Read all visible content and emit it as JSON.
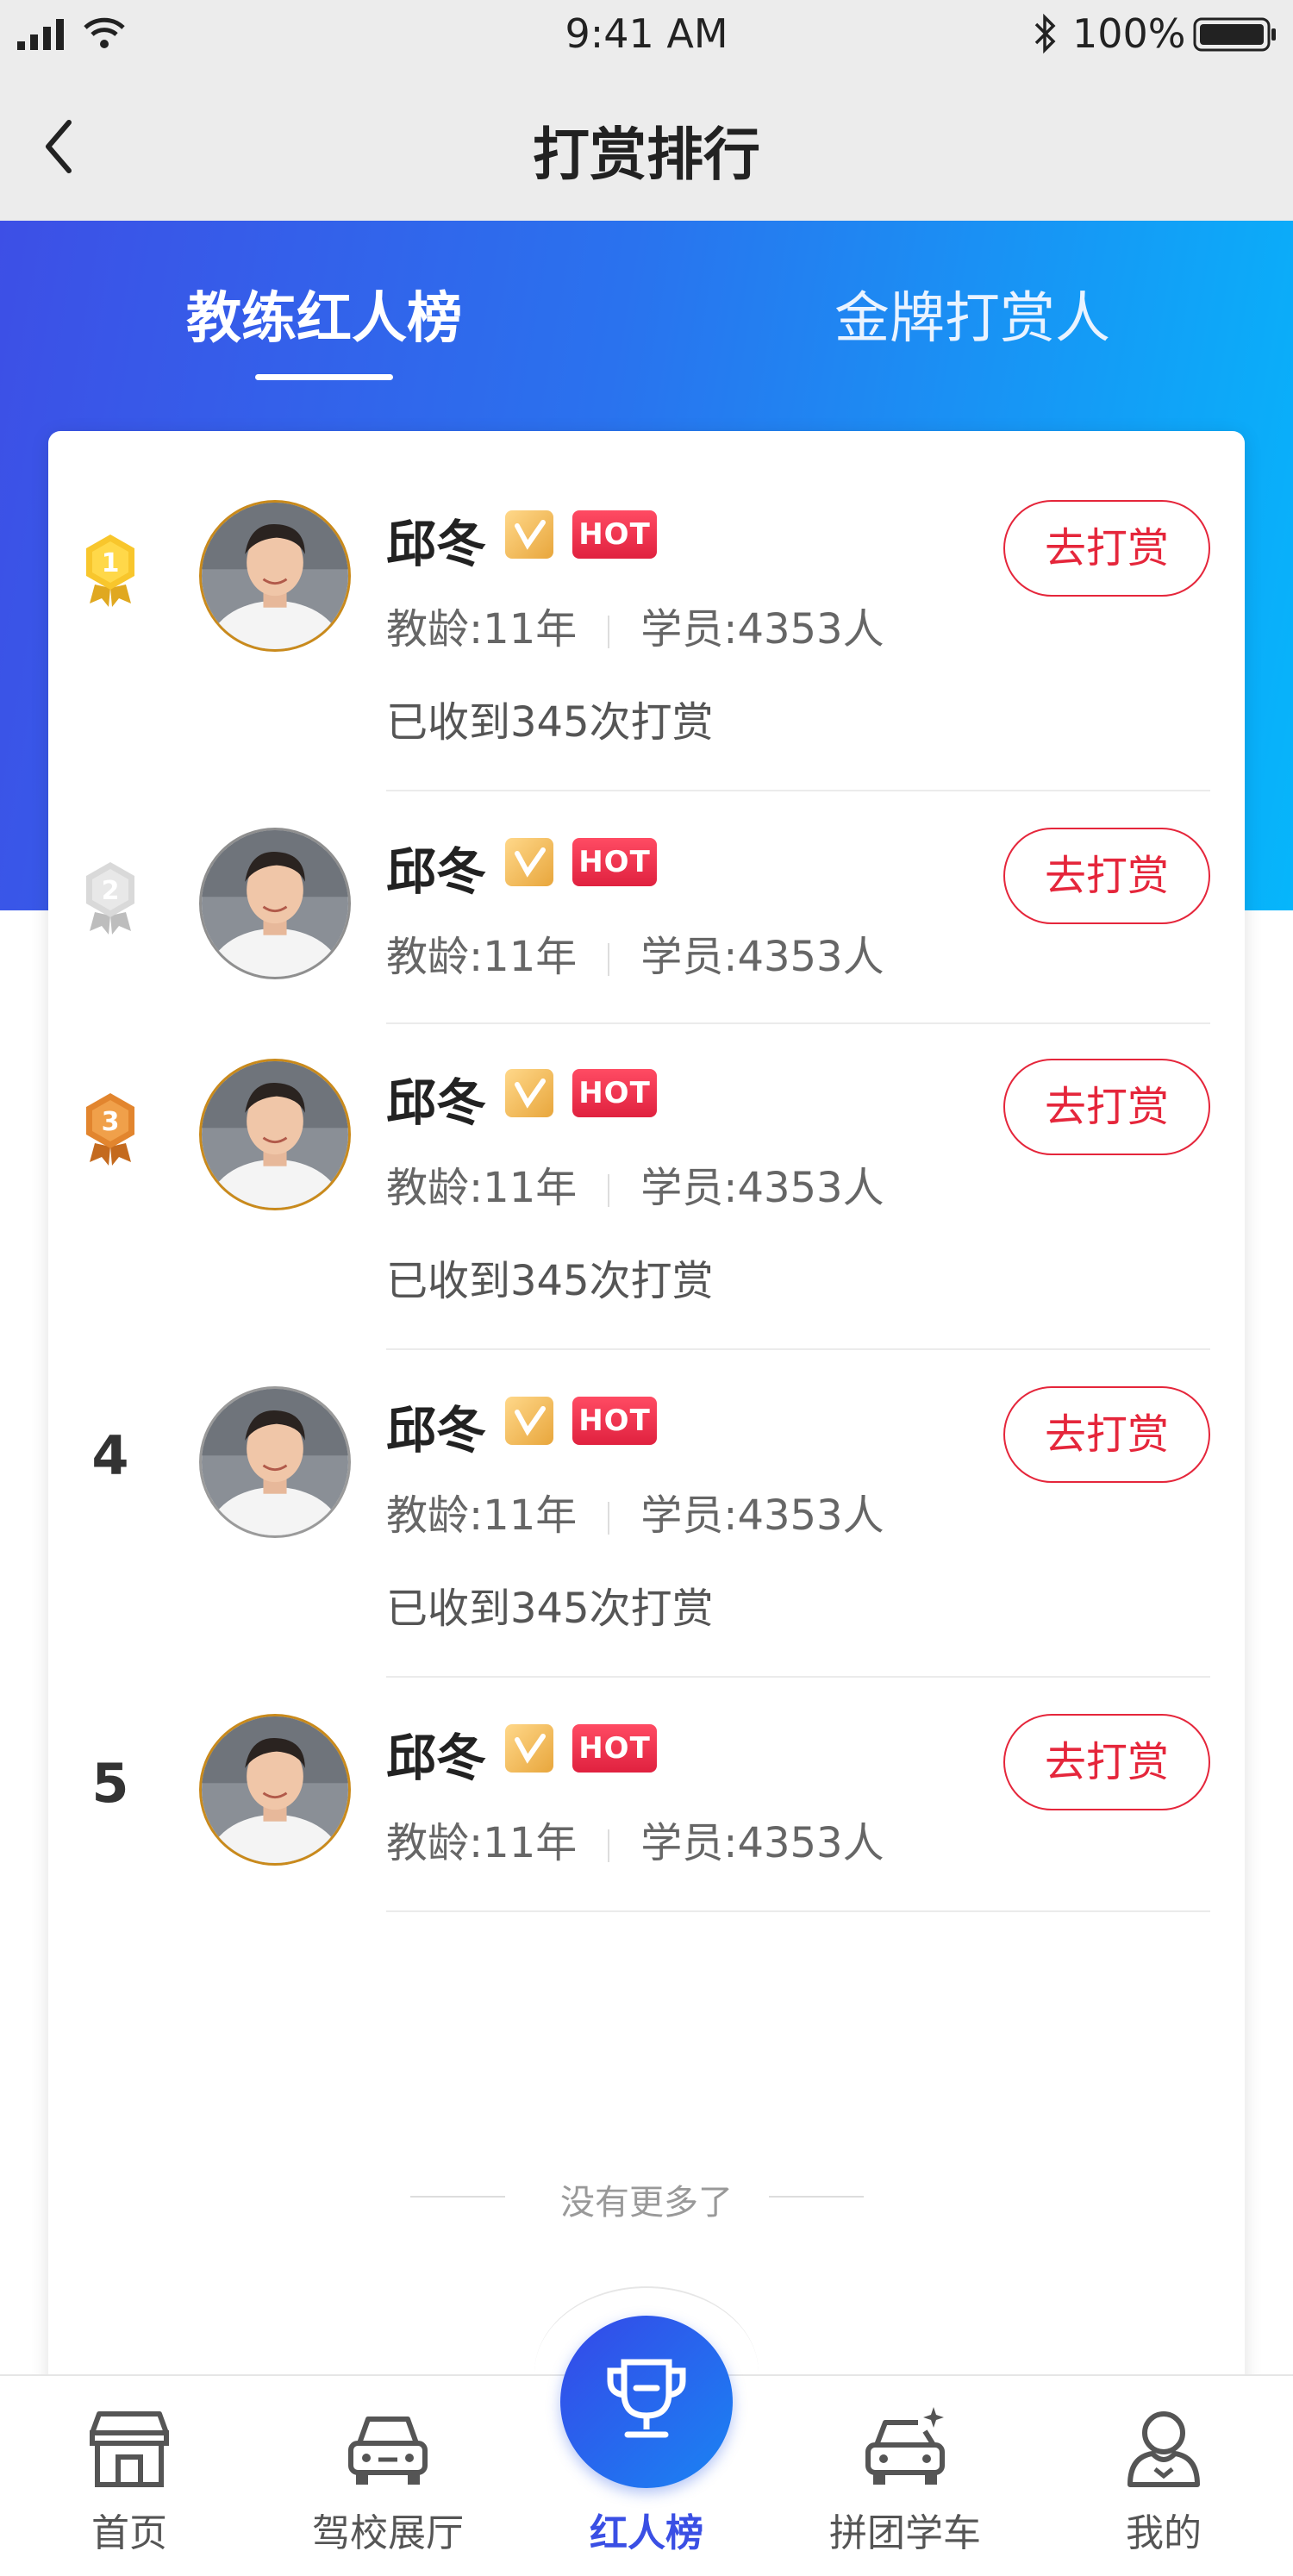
{
  "status_bar": {
    "time": "9:41 AM",
    "battery": "100%"
  },
  "nav": {
    "title": "打赏排行"
  },
  "tabs": [
    {
      "label": "教练红人榜",
      "active": true
    },
    {
      "label": "金牌打赏人",
      "active": false
    }
  ],
  "coaches": [
    {
      "rank": "1",
      "rank_type": "gold-medal",
      "name": "邱冬",
      "badge_hot": "HOT",
      "years": "教龄:11年",
      "students": "学员:4353人",
      "tips": "已收到345次打赏",
      "button": "去打赏"
    },
    {
      "rank": "2",
      "rank_type": "silver-medal",
      "name": "邱冬",
      "badge_hot": "HOT",
      "years": "教龄:11年",
      "students": "学员:4353人",
      "tips": "",
      "button": "去打赏"
    },
    {
      "rank": "3",
      "rank_type": "bronze-medal",
      "name": "邱冬",
      "badge_hot": "HOT",
      "years": "教龄:11年",
      "students": "学员:4353人",
      "tips": "已收到345次打赏",
      "button": "去打赏"
    },
    {
      "rank": "4",
      "rank_type": "number",
      "name": "邱冬",
      "badge_hot": "HOT",
      "years": "教龄:11年",
      "students": "学员:4353人",
      "tips": "已收到345次打赏",
      "button": "去打赏"
    },
    {
      "rank": "5",
      "rank_type": "number",
      "name": "邱冬",
      "badge_hot": "HOT",
      "years": "教龄:11年",
      "students": "学员:4353人",
      "tips": "",
      "button": "去打赏"
    }
  ],
  "footer_text": "没有更多了",
  "tabbar": [
    {
      "label": "首页",
      "icon": "store-icon"
    },
    {
      "label": "驾校展厅",
      "icon": "car-icon"
    },
    {
      "label": "红人榜",
      "icon": "trophy-icon",
      "active": true
    },
    {
      "label": "拼团学车",
      "icon": "car-sparkle-icon"
    },
    {
      "label": "我的",
      "icon": "user-icon"
    }
  ],
  "colors": {
    "accent": "#3a4fe4",
    "reward_red": "#e5263b",
    "gradient_start": "#3d4fe6",
    "gradient_end": "#06b6fb"
  }
}
